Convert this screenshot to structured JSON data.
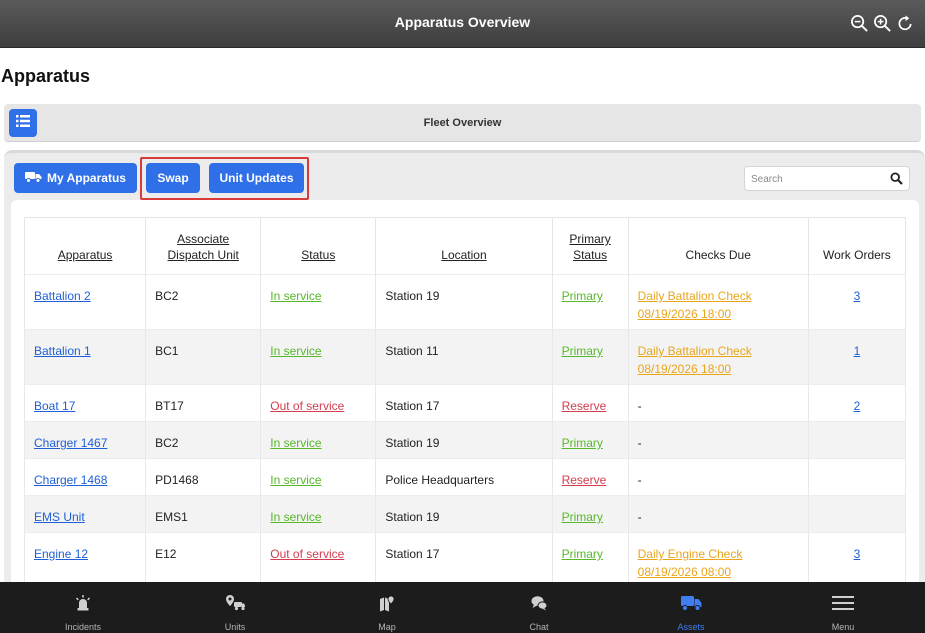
{
  "header": {
    "title": "Apparatus Overview"
  },
  "page": {
    "title": "Apparatus"
  },
  "fleet_bar": {
    "label": "Fleet Overview"
  },
  "toolbar": {
    "my_apparatus_label": "My Apparatus",
    "swap_label": "Swap",
    "unit_updates_label": "Unit Updates",
    "search_placeholder": "Search",
    "search_value": ""
  },
  "colors": {
    "accent": "#2f6fe8",
    "in_service": "#58b82b",
    "out_of_service": "#d23d4f",
    "checks_due": "#e9a51c",
    "highlight": "#d93a3a"
  },
  "table": {
    "headers": {
      "apparatus": "Apparatus",
      "associate_line1": "Associate",
      "associate_line2": "Dispatch Unit",
      "status": "Status",
      "location": "Location",
      "primary_line1": "Primary",
      "primary_line2": "Status",
      "checks_due": "Checks Due",
      "work_orders": "Work Orders"
    },
    "rows": [
      {
        "apparatus": "Battalion 2",
        "unit": "BC2",
        "status": "In service",
        "location": "Station 19",
        "primary": "Primary",
        "checks_line1": "Daily Battalion Check",
        "checks_line2": "08/19/2026 18:00",
        "work_orders": "3"
      },
      {
        "apparatus": "Battalion 1",
        "unit": "BC1",
        "status": "In service",
        "location": "Station 11",
        "primary": "Primary",
        "checks_line1": "Daily Battalion Check",
        "checks_line2": "08/19/2026 18:00",
        "work_orders": "1"
      },
      {
        "apparatus": "Boat 17",
        "unit": "BT17",
        "status": "Out of service",
        "location": "Station 17",
        "primary": "Reserve",
        "checks_line1": "-",
        "checks_line2": "",
        "work_orders": "2"
      },
      {
        "apparatus": "Charger 1467",
        "unit": "BC2",
        "status": "In service",
        "location": "Station 19",
        "primary": "Primary",
        "checks_line1": "-",
        "checks_line2": "",
        "work_orders": ""
      },
      {
        "apparatus": "Charger 1468",
        "unit": "PD1468",
        "status": "In service",
        "location": "Police Headquarters",
        "primary": "Reserve",
        "checks_line1": "-",
        "checks_line2": "",
        "work_orders": ""
      },
      {
        "apparatus": "EMS Unit",
        "unit": "EMS1",
        "status": "In service",
        "location": "Station 19",
        "primary": "Primary",
        "checks_line1": "-",
        "checks_line2": "",
        "work_orders": ""
      },
      {
        "apparatus": "Engine 12",
        "unit": "E12",
        "status": "Out of service",
        "location": "Station 17",
        "primary": "Primary",
        "checks_line1": "Daily Engine Check",
        "checks_line2": "08/19/2026 08:00",
        "work_orders": "3"
      }
    ]
  },
  "bottom_nav": [
    {
      "label": "Incidents",
      "icon": "siren-icon"
    },
    {
      "label": "Units",
      "icon": "units-icon"
    },
    {
      "label": "Map",
      "icon": "map-icon"
    },
    {
      "label": "Chat",
      "icon": "chat-icon"
    },
    {
      "label": "Assets",
      "icon": "truck-icon"
    },
    {
      "label": "Menu",
      "icon": "menu-icon"
    }
  ]
}
